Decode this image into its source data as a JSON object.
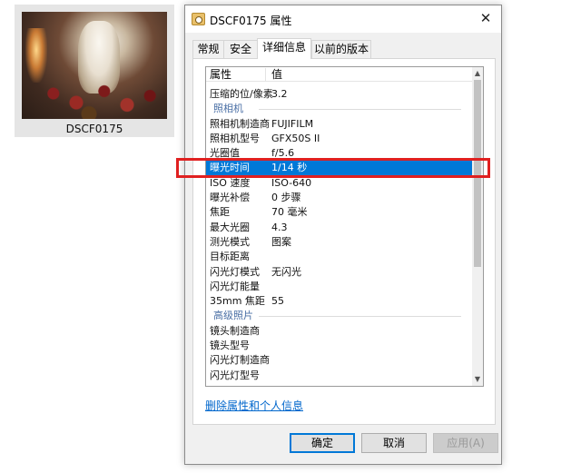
{
  "thumbnail": {
    "filename": "DSCF0175"
  },
  "dialog": {
    "title": "DSCF0175 属性",
    "close_glyph": "✕",
    "tabs": [
      {
        "label": "常规",
        "active": false
      },
      {
        "label": "安全",
        "active": false
      },
      {
        "label": "详细信息",
        "active": true
      },
      {
        "label": "以前的版本",
        "active": false
      }
    ],
    "list": {
      "header_property": "属性",
      "header_value": "值",
      "cut_row": {
        "k": "",
        "v": ""
      },
      "rows": [
        {
          "k": "压缩的位/像素",
          "v": "3.2"
        },
        {
          "k": "照相机",
          "v": "",
          "group": true
        },
        {
          "k": "照相机制造商",
          "v": "FUJIFILM"
        },
        {
          "k": "照相机型号",
          "v": "GFX50S II"
        },
        {
          "k": "光圈值",
          "v": "f/5.6"
        },
        {
          "k": "曝光时间",
          "v": "1/14 秒",
          "selected": true
        },
        {
          "k": "ISO 速度",
          "v": "ISO-640"
        },
        {
          "k": "曝光补偿",
          "v": "0 步骤"
        },
        {
          "k": "焦距",
          "v": "70 毫米"
        },
        {
          "k": "最大光圈",
          "v": "4.3"
        },
        {
          "k": "测光模式",
          "v": "图案"
        },
        {
          "k": "目标距离",
          "v": ""
        },
        {
          "k": "闪光灯模式",
          "v": "无闪光"
        },
        {
          "k": "闪光灯能量",
          "v": ""
        },
        {
          "k": "35mm 焦距",
          "v": "55"
        },
        {
          "k": "高级照片",
          "v": "",
          "group": true
        },
        {
          "k": "镜头制造商",
          "v": ""
        },
        {
          "k": "镜头型号",
          "v": ""
        },
        {
          "k": "闪光灯制造商",
          "v": ""
        },
        {
          "k": "闪光灯型号",
          "v": ""
        }
      ],
      "scroll_up_glyph": "▲",
      "scroll_down_glyph": "▼"
    },
    "remove_link": "删除属性和个人信息",
    "buttons": {
      "ok": "确定",
      "cancel": "取消",
      "apply": "应用(A)"
    }
  },
  "colors": {
    "selection": "#0078d7",
    "highlight_box": "#e02020",
    "link": "#0066cc"
  }
}
